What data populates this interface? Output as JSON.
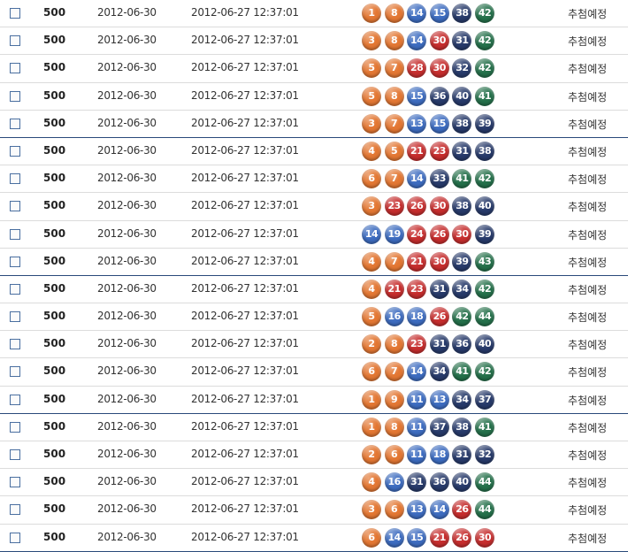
{
  "colors": {
    "orange": "#e37733",
    "blue": "#3d6cc0",
    "red": "#c62d2d",
    "navy": "#273a6a",
    "green": "#24704a"
  },
  "rows": [
    {
      "round": "500",
      "draw_date": "2012-06-30",
      "purchase_date": "2012-06-27 12:37:01",
      "numbers": [
        1,
        8,
        14,
        15,
        38,
        42
      ],
      "status": "추첨예정"
    },
    {
      "round": "500",
      "draw_date": "2012-06-30",
      "purchase_date": "2012-06-27 12:37:01",
      "numbers": [
        3,
        8,
        14,
        30,
        31,
        42
      ],
      "status": "추첨예정"
    },
    {
      "round": "500",
      "draw_date": "2012-06-30",
      "purchase_date": "2012-06-27 12:37:01",
      "numbers": [
        5,
        7,
        28,
        30,
        32,
        42
      ],
      "status": "추첨예정"
    },
    {
      "round": "500",
      "draw_date": "2012-06-30",
      "purchase_date": "2012-06-27 12:37:01",
      "numbers": [
        5,
        8,
        15,
        36,
        40,
        41
      ],
      "status": "추첨예정"
    },
    {
      "round": "500",
      "draw_date": "2012-06-30",
      "purchase_date": "2012-06-27 12:37:01",
      "numbers": [
        3,
        7,
        13,
        15,
        38,
        39
      ],
      "status": "추첨예정"
    },
    {
      "round": "500",
      "draw_date": "2012-06-30",
      "purchase_date": "2012-06-27 12:37:01",
      "numbers": [
        4,
        5,
        21,
        23,
        31,
        38
      ],
      "status": "추첨예정"
    },
    {
      "round": "500",
      "draw_date": "2012-06-30",
      "purchase_date": "2012-06-27 12:37:01",
      "numbers": [
        6,
        7,
        14,
        33,
        41,
        42
      ],
      "status": "추첨예정"
    },
    {
      "round": "500",
      "draw_date": "2012-06-30",
      "purchase_date": "2012-06-27 12:37:01",
      "numbers": [
        3,
        23,
        26,
        30,
        38,
        40
      ],
      "status": "추첨예정"
    },
    {
      "round": "500",
      "draw_date": "2012-06-30",
      "purchase_date": "2012-06-27 12:37:01",
      "numbers": [
        14,
        19,
        24,
        26,
        30,
        39
      ],
      "status": "추첨예정"
    },
    {
      "round": "500",
      "draw_date": "2012-06-30",
      "purchase_date": "2012-06-27 12:37:01",
      "numbers": [
        4,
        7,
        21,
        30,
        39,
        43
      ],
      "status": "추첨예정"
    },
    {
      "round": "500",
      "draw_date": "2012-06-30",
      "purchase_date": "2012-06-27 12:37:01",
      "numbers": [
        4,
        21,
        23,
        31,
        34,
        42
      ],
      "status": "추첨예정"
    },
    {
      "round": "500",
      "draw_date": "2012-06-30",
      "purchase_date": "2012-06-27 12:37:01",
      "numbers": [
        5,
        16,
        18,
        26,
        42,
        44
      ],
      "status": "추첨예정"
    },
    {
      "round": "500",
      "draw_date": "2012-06-30",
      "purchase_date": "2012-06-27 12:37:01",
      "numbers": [
        2,
        8,
        23,
        31,
        36,
        40
      ],
      "status": "추첨예정"
    },
    {
      "round": "500",
      "draw_date": "2012-06-30",
      "purchase_date": "2012-06-27 12:37:01",
      "numbers": [
        6,
        7,
        14,
        34,
        41,
        42
      ],
      "status": "추첨예정"
    },
    {
      "round": "500",
      "draw_date": "2012-06-30",
      "purchase_date": "2012-06-27 12:37:01",
      "numbers": [
        1,
        9,
        11,
        13,
        34,
        37
      ],
      "status": "추첨예정"
    },
    {
      "round": "500",
      "draw_date": "2012-06-30",
      "purchase_date": "2012-06-27 12:37:01",
      "numbers": [
        1,
        8,
        11,
        37,
        38,
        41
      ],
      "status": "추첨예정"
    },
    {
      "round": "500",
      "draw_date": "2012-06-30",
      "purchase_date": "2012-06-27 12:37:01",
      "numbers": [
        2,
        6,
        11,
        18,
        31,
        32
      ],
      "status": "추첨예정"
    },
    {
      "round": "500",
      "draw_date": "2012-06-30",
      "purchase_date": "2012-06-27 12:37:01",
      "numbers": [
        4,
        16,
        31,
        36,
        40,
        44
      ],
      "status": "추첨예정"
    },
    {
      "round": "500",
      "draw_date": "2012-06-30",
      "purchase_date": "2012-06-27 12:37:01",
      "numbers": [
        3,
        6,
        13,
        14,
        26,
        44
      ],
      "status": "추첨예정"
    },
    {
      "round": "500",
      "draw_date": "2012-06-30",
      "purchase_date": "2012-06-27 12:37:01",
      "numbers": [
        6,
        14,
        15,
        21,
        26,
        30
      ],
      "status": "추첨예정"
    }
  ]
}
